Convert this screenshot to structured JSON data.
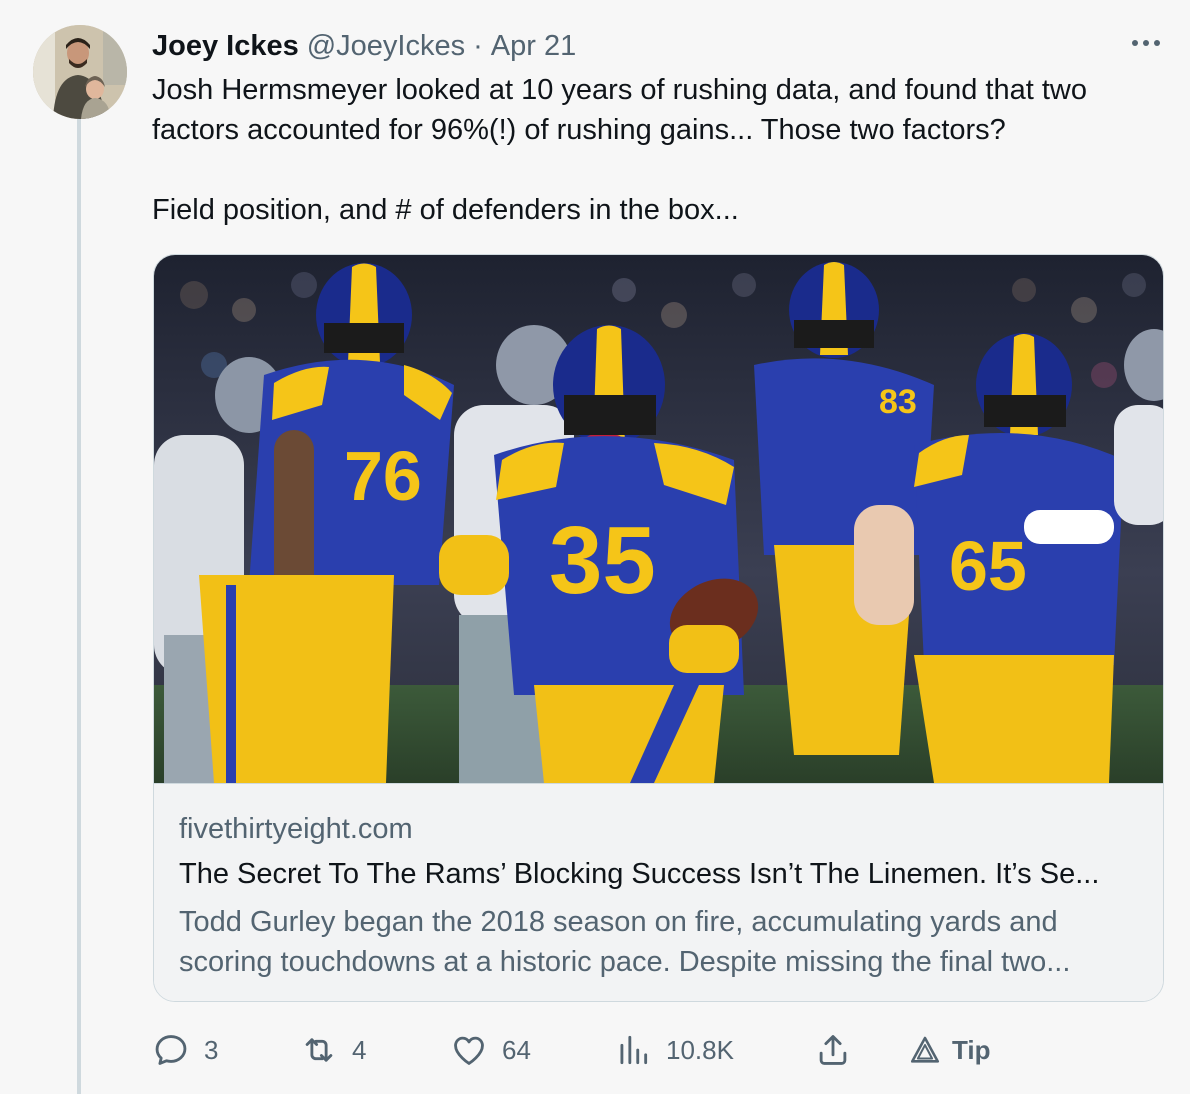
{
  "tweet": {
    "author": {
      "display_name": "Joey Ickes",
      "handle": "@JoeyIckes",
      "separator": "·",
      "date": "Apr 21"
    },
    "text_lines": [
      "Josh Hermsmeyer looked at 10 years of rushing data, and found that two",
      "factors accounted for 96%(!) of rushing gains... Those two factors?",
      "Field position, and # of defenders in the box..."
    ],
    "card": {
      "domain": "fivethirtyeight.com",
      "title": "The Secret To The Rams’ Blocking Success Isn’t The Linemen. It’s Se...",
      "description_lines": [
        "Todd Gurley began the 2018 season on fire, accumulating yards and",
        "scoring touchdowns at a historic pace. Despite missing the final two..."
      ],
      "image_jersey_numbers": [
        "76",
        "35",
        "83",
        "65"
      ]
    },
    "actions": {
      "replies": "3",
      "retweets": "4",
      "likes": "64",
      "views": "10.8K",
      "tip_label": "Tip"
    }
  },
  "icons": {
    "more": "more-horizontal-icon",
    "reply": "reply-icon",
    "retweet": "retweet-icon",
    "like": "heart-icon",
    "views": "views-chart-icon",
    "share": "share-icon",
    "tip": "tip-icon"
  },
  "colors": {
    "background": "#f7f7f7",
    "text_primary": "#0f1419",
    "text_secondary": "#536471",
    "border": "#cfd9de",
    "rams_blue": "#2a3fae",
    "rams_gold": "#f5c518"
  }
}
